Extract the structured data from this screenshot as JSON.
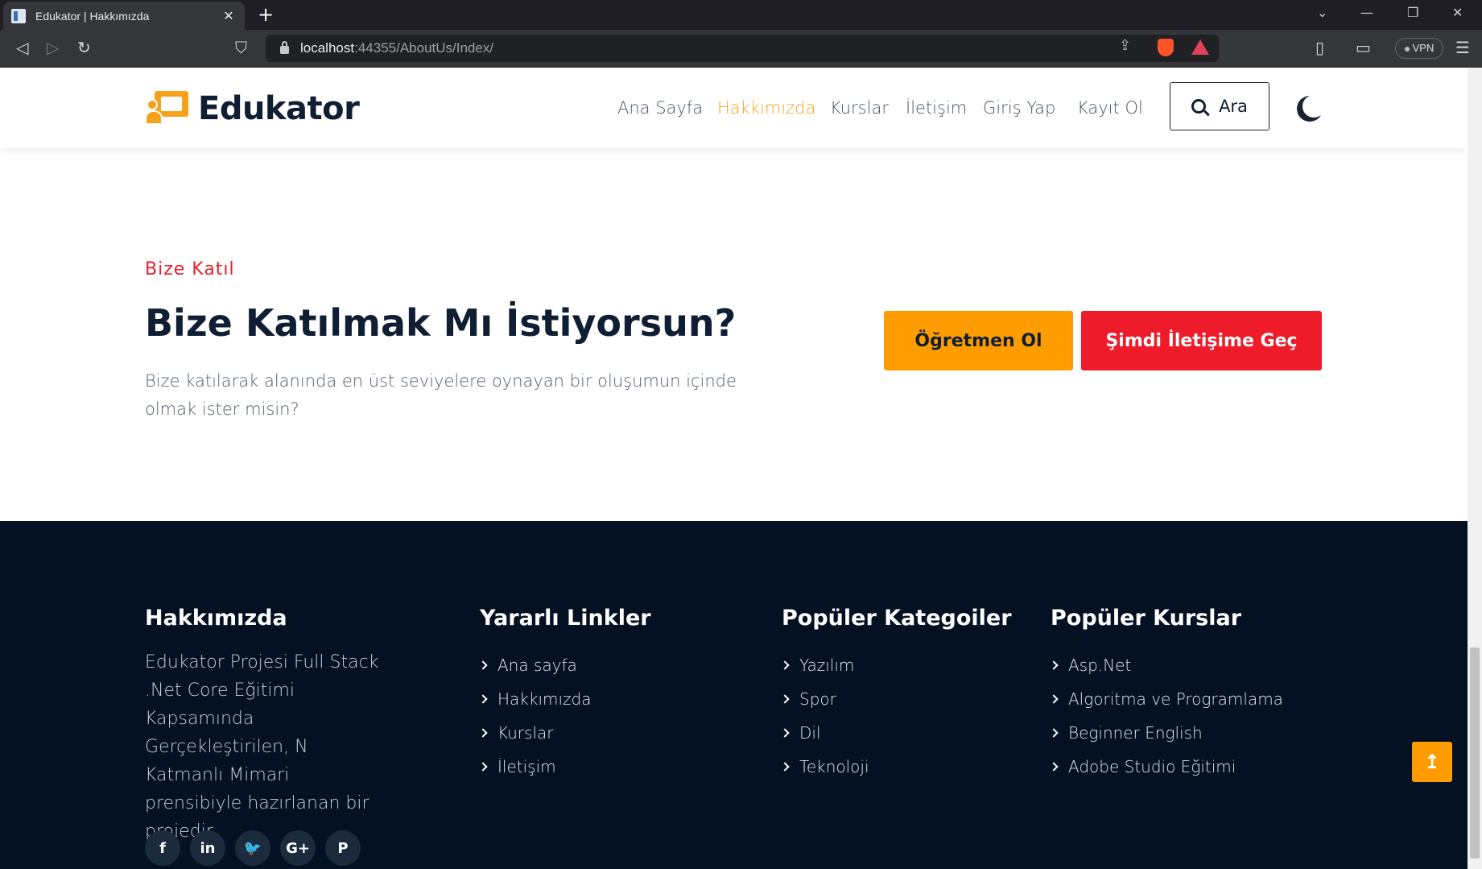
{
  "browser": {
    "tab_title": "Edukator | Hakkımızda",
    "url_host": "localhost",
    "url_rest": ":44355/AboutUs/Index/",
    "vpn_label": "VPN"
  },
  "header": {
    "logo_text": "Edukator",
    "nav": [
      "Ana Sayfa",
      "Hakkımızda",
      "Kurslar",
      "İletişim",
      "Giriş Yap",
      "Kayıt Ol"
    ],
    "active_nav": "Hakkımızda",
    "search_label": "Ara"
  },
  "join": {
    "eyebrow": "Bize Katıl",
    "title": "Bize Katılmak Mı İstiyorsun?",
    "text": "Bize katılarak alanında en üst seviyelere oynayan bir oluşumun içinde olmak ister misin?",
    "teacher_button": "Öğretmen Ol",
    "contact_button": "Şimdi İletişime Geç"
  },
  "footer": {
    "about": {
      "heading": "Hakkımızda",
      "text": "Edukator Projesi Full Stack .Net Core Eğitimi Kapsamında Gerçekleştirilen, N Katmanlı Mimari prensibiyle hazırlanan bir projedir."
    },
    "links": {
      "heading": "Yararlı Linkler",
      "items": [
        "Ana sayfa",
        "Hakkımızda",
        "Kurslar",
        "İletişim"
      ]
    },
    "categories": {
      "heading": "Popüler Kategoiler",
      "items": [
        "Yazılım",
        "Spor",
        "Dil",
        "Teknoloji"
      ]
    },
    "courses": {
      "heading": "Popüler Kurslar",
      "items": [
        "Asp.Net",
        "Algoritma ve Programlama",
        "Beginner English",
        "Adobe Studio Eğitimi"
      ]
    },
    "socials": [
      {
        "icon": "facebook-icon",
        "glyph": "f"
      },
      {
        "icon": "linkedin-icon",
        "glyph": "in"
      },
      {
        "icon": "twitter-icon",
        "glyph": "🐦"
      },
      {
        "icon": "google-plus-icon",
        "glyph": "G+"
      },
      {
        "icon": "pinterest-icon",
        "glyph": "P"
      }
    ]
  },
  "colors": {
    "brand_orange": "#ff9d00",
    "accent_red": "#ee1c2a",
    "footer_bg": "#031122",
    "heading_dark": "#101e33"
  }
}
